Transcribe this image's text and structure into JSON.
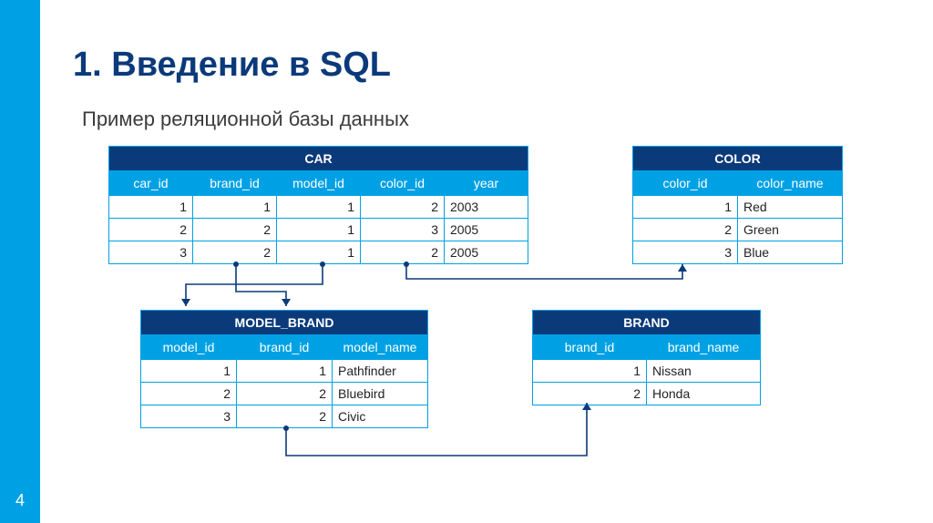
{
  "page_number": "4",
  "title": "1. Введение в SQL",
  "subtitle": "Пример реляционной базы данных",
  "tables": {
    "car": {
      "name": "CAR",
      "columns": [
        "car_id",
        "brand_id",
        "model_id",
        "color_id",
        "year"
      ],
      "rows": [
        [
          "1",
          "1",
          "1",
          "2",
          "2003"
        ],
        [
          "2",
          "2",
          "1",
          "3",
          "2005"
        ],
        [
          "3",
          "2",
          "1",
          "2",
          "2005"
        ]
      ]
    },
    "color": {
      "name": "COLOR",
      "columns": [
        "color_id",
        "color_name"
      ],
      "rows": [
        [
          "1",
          "Red"
        ],
        [
          "2",
          "Green"
        ],
        [
          "3",
          "Blue"
        ]
      ]
    },
    "model_brand": {
      "name": "MODEL_BRAND",
      "columns": [
        "model_id",
        "brand_id",
        "model_name"
      ],
      "rows": [
        [
          "1",
          "1",
          "Pathfinder"
        ],
        [
          "2",
          "2",
          "Bluebird"
        ],
        [
          "3",
          "2",
          "Civic"
        ]
      ]
    },
    "brand": {
      "name": "BRAND",
      "columns": [
        "brand_id",
        "brand_name"
      ],
      "rows": [
        [
          "1",
          "Nissan"
        ],
        [
          "2",
          "Honda"
        ]
      ]
    }
  }
}
